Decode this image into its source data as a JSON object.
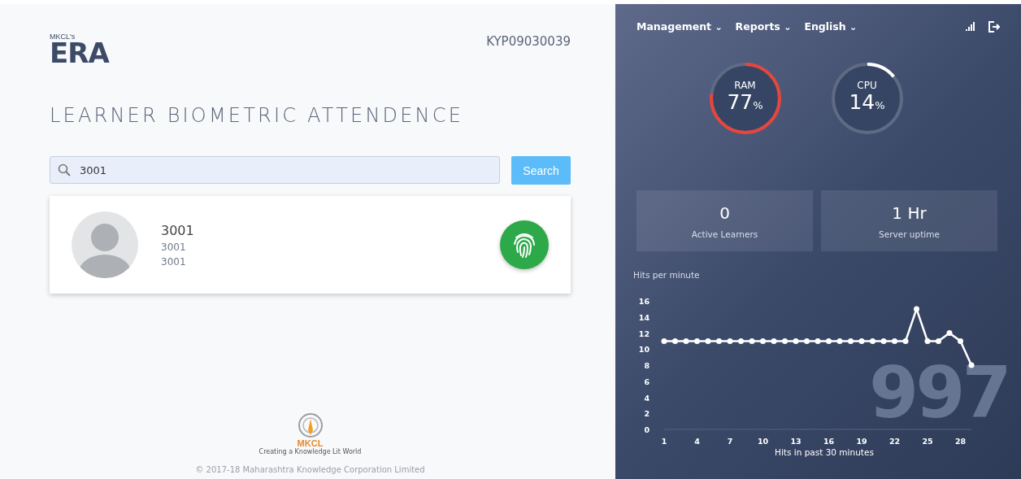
{
  "header": {
    "logo_small": "MKCL's",
    "logo": "ERA",
    "center_code": "KYP09030039"
  },
  "title": "LEARNER BIOMETRIC ATTENDENCE",
  "search": {
    "value": "3001",
    "button": "Search"
  },
  "learner": {
    "name": "3001",
    "line_1": "3001",
    "line_2": "3001"
  },
  "footer": {
    "brand": "MKCL",
    "tagline": "Creating a Knowledge Lit World",
    "copyright": "© 2017-18 Maharashtra Knowledge Corporation Limited"
  },
  "nav": [
    {
      "label": "Management",
      "caret": "⌄"
    },
    {
      "label": "Reports",
      "caret": "⌄"
    },
    {
      "label": "English",
      "caret": "⌄"
    }
  ],
  "gauges": [
    {
      "label": "RAM",
      "value": "77",
      "unit": "%",
      "level": 0.77,
      "color": "#e8453c"
    },
    {
      "label": "CPU",
      "value": "14",
      "unit": "%",
      "level": 0.14,
      "color": "#ffffff"
    }
  ],
  "stats": [
    {
      "value": "0",
      "label": "Active Learners"
    },
    {
      "value": "1 Hr",
      "label": "Server uptime"
    }
  ],
  "hits": {
    "big_number": "997",
    "chart_data": {
      "type": "line",
      "ylabel": "Hits per minute",
      "xlabel": "Hits in past 30 minutes",
      "x": [
        1,
        2,
        3,
        4,
        5,
        6,
        7,
        8,
        9,
        10,
        11,
        12,
        13,
        14,
        15,
        16,
        17,
        18,
        19,
        20,
        21,
        22,
        23,
        24,
        25,
        26,
        27,
        28,
        29
      ],
      "series": [
        {
          "color": "#ffffff",
          "marker": "circle",
          "values": [
            11,
            11,
            11,
            11,
            11,
            11,
            11,
            11,
            11,
            11,
            11,
            11,
            11,
            11,
            11,
            11,
            11,
            11,
            11,
            11,
            11,
            11,
            11,
            15,
            11,
            11,
            12,
            11,
            8
          ]
        }
      ],
      "xlim": [
        1,
        29
      ],
      "ylim": [
        0,
        16
      ],
      "xticks": [
        1,
        4,
        7,
        10,
        13,
        16,
        19,
        22,
        25,
        28
      ],
      "yticks": [
        0,
        2,
        4,
        6,
        8,
        10,
        12,
        14,
        16
      ]
    }
  }
}
